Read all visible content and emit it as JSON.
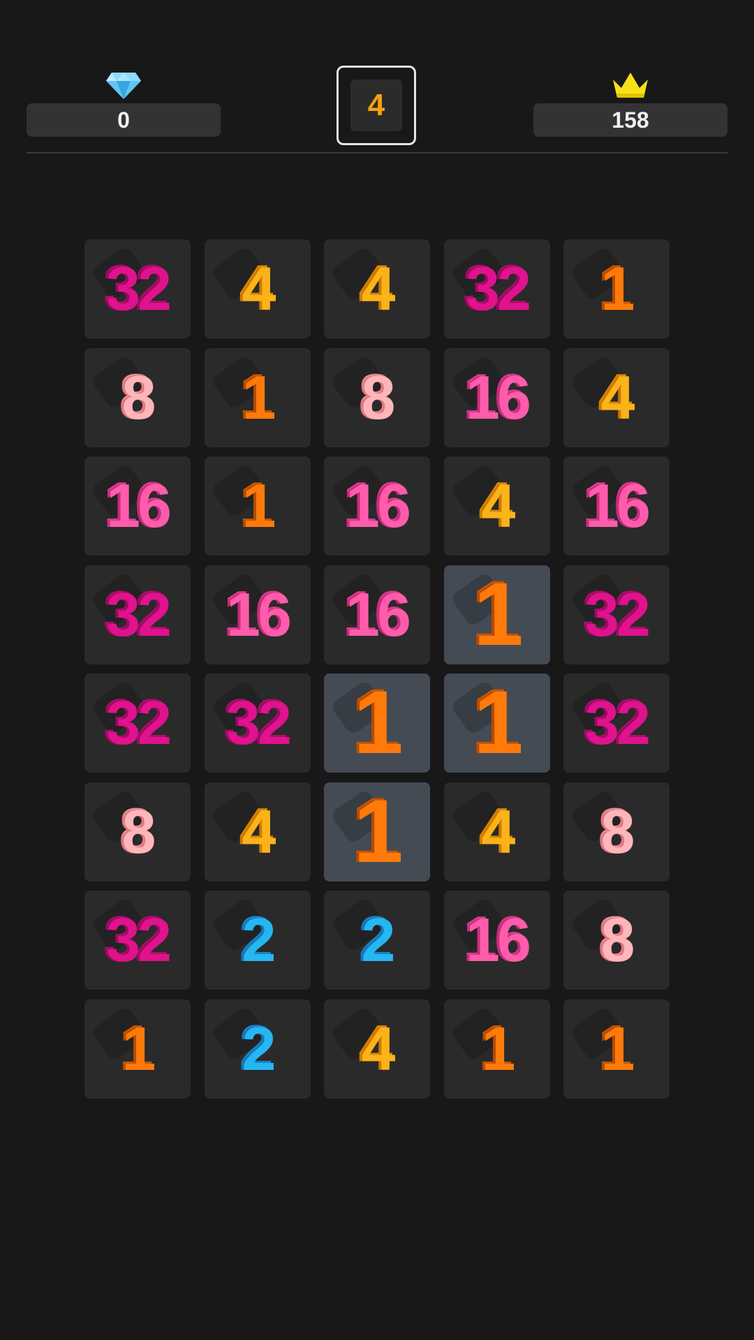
{
  "header": {
    "gems": {
      "icon": "diamond-icon",
      "value": "0"
    },
    "next_tile": {
      "value": "4"
    },
    "best": {
      "icon": "crown-icon",
      "value": "158"
    }
  },
  "colors": {
    "1": "#ff7a0a",
    "2": "#25b7f2",
    "4": "#fbb31a",
    "8": "#ffb6ba",
    "16": "#ff5cac",
    "32": "#e0128e"
  },
  "board": {
    "rows": [
      [
        "32",
        "4",
        "4",
        "32",
        "1"
      ],
      [
        "8",
        "1",
        "8",
        "16",
        "4"
      ],
      [
        "16",
        "1",
        "16",
        "4",
        "16"
      ],
      [
        "32",
        "16",
        "16",
        "1",
        "32"
      ],
      [
        "32",
        "32",
        "1",
        "1",
        "32"
      ],
      [
        "8",
        "4",
        "1",
        "4",
        "8"
      ],
      [
        "32",
        "2",
        "2",
        "16",
        "8"
      ],
      [
        "1",
        "2",
        "4",
        "1",
        "1"
      ]
    ],
    "selected": [
      [
        3,
        3
      ],
      [
        4,
        2
      ],
      [
        4,
        3
      ],
      [
        5,
        2
      ]
    ]
  }
}
